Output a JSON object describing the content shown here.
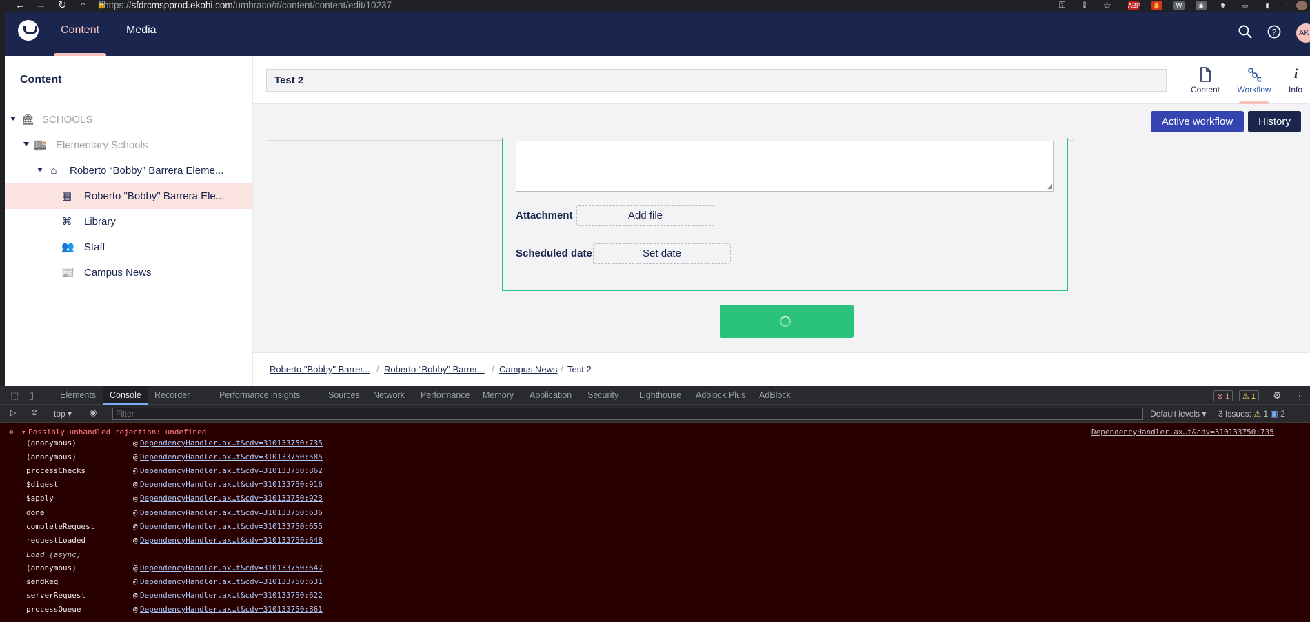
{
  "browser": {
    "url_scheme": "https://",
    "url_host": "sfdrcmspprod.ekohi.com",
    "url_path": "/umbraco/#/content/content/edit/10237"
  },
  "topnav": {
    "tabs": [
      {
        "label": "Content",
        "active": true
      },
      {
        "label": "Media",
        "active": false
      }
    ],
    "avatar_initials": "AK"
  },
  "tree": {
    "title": "Content",
    "nodes": [
      {
        "label": "SCHOOLS",
        "icon": "building-icon"
      },
      {
        "label": "Elementary Schools",
        "icon": "store-icon"
      },
      {
        "label": "Roberto “Bobby” Barrera Eleme...",
        "icon": "home-icon"
      },
      {
        "label": "Roberto \"Bobby\" Barrera Ele...",
        "icon": "grid-icon"
      },
      {
        "label": "Library",
        "icon": "command-icon"
      },
      {
        "label": "Staff",
        "icon": "users-icon"
      },
      {
        "label": "Campus News",
        "icon": "newspaper-icon"
      }
    ]
  },
  "editor": {
    "name_value": "Test 2",
    "apps": [
      {
        "label": "Content",
        "icon": "document-icon"
      },
      {
        "label": "Workflow",
        "icon": "workflow-icon"
      },
      {
        "label": "Info",
        "icon": "info-icon"
      }
    ],
    "buttons": {
      "active_workflow": "Active workflow",
      "history": "History"
    },
    "attachment_label": "Attachment",
    "add_file": "Add file",
    "scheduled_label": "Scheduled date",
    "set_date": "Set date"
  },
  "breadcrumb": [
    "Roberto \"Bobby\" Barrer...",
    "Roberto \"Bobby\" Barrer...",
    "Campus News",
    "Test 2"
  ],
  "devtools": {
    "tabs": [
      "Elements",
      "Console",
      "Recorder",
      "Performance insights",
      "Sources",
      "Network",
      "Performance",
      "Memory",
      "Application",
      "Security",
      "Lighthouse",
      "Adblock Plus",
      "AdBlock"
    ],
    "error_count": "1",
    "warning_count": "1",
    "context": "top",
    "filter_placeholder": "Filter",
    "levels": "Default levels",
    "issues_label": "3 Issues:",
    "issues_warn": "1",
    "issues_info": "2",
    "error_message": "Possibly unhandled rejection: undefined",
    "error_source": "DependencyHandler.ax…t&cdv=310133750:735",
    "frames": [
      {
        "fn": "(anonymous)",
        "src": "DependencyHandler.ax…t&cdv=310133750:735"
      },
      {
        "fn": "(anonymous)",
        "src": "DependencyHandler.ax…t&cdv=310133750:585"
      },
      {
        "fn": "processChecks",
        "src": "DependencyHandler.ax…t&cdv=310133750:862"
      },
      {
        "fn": "$digest",
        "src": "DependencyHandler.ax…t&cdv=310133750:916"
      },
      {
        "fn": "$apply",
        "src": "DependencyHandler.ax…t&cdv=310133750:923"
      },
      {
        "fn": "done",
        "src": "DependencyHandler.ax…t&cdv=310133750:636"
      },
      {
        "fn": "completeRequest",
        "src": "DependencyHandler.ax…t&cdv=310133750:655"
      },
      {
        "fn": "requestLoaded",
        "src": "DependencyHandler.ax…t&cdv=310133750:648"
      }
    ],
    "async_label": "Load (async)",
    "frames_after": [
      {
        "fn": "(anonymous)",
        "src": "DependencyHandler.ax…t&cdv=310133750:647"
      },
      {
        "fn": "sendReq",
        "src": "DependencyHandler.ax…t&cdv=310133750:631"
      },
      {
        "fn": "serverRequest",
        "src": "DependencyHandler.ax…t&cdv=310133750:622"
      },
      {
        "fn": "processQueue",
        "src": "DependencyHandler.ax…t&cdv=310133750:861"
      }
    ]
  },
  "colors": {
    "nav_bg": "#1b264f",
    "accent_pink": "#f5c1bc",
    "success_green": "#2bc37c",
    "primary_blue": "#3544b1"
  }
}
